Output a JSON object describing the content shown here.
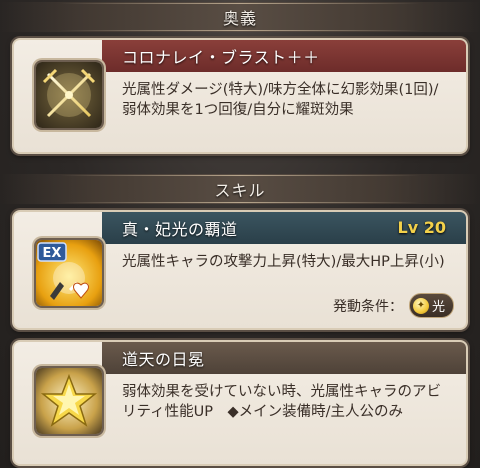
{
  "ougi_section": {
    "header": "奥義",
    "card": {
      "name": "コロナレイ・ブラスト＋＋",
      "description": "光属性ダメージ(特大)/味方全体に幻影効果(1回)/弱体効果を1つ回復/自分に耀斑効果",
      "icon": "crossed-swords-icon"
    }
  },
  "skill_section": {
    "header": "スキル",
    "skills": [
      {
        "name": "真・妃光の覇道",
        "level": "Lv 20",
        "description": "光属性キャラの攻撃力上昇(特大)/最大HP上昇(小)",
        "condition_label": "発動条件：",
        "condition_value": "光",
        "icon": "ex-skill-icon",
        "icon_badge": "EX"
      },
      {
        "name": "道天の日冕",
        "description": "弱体効果を受けていない時、光属性キャラのアビリティ性能UP　◆メイン装備時/主人公のみ",
        "icon": "star-icon"
      }
    ]
  },
  "colors": {
    "ougi_title": "#6d2c2a",
    "skill_title": "#2a3f49",
    "support_title": "#4e4238",
    "level": "#f3d14a"
  }
}
